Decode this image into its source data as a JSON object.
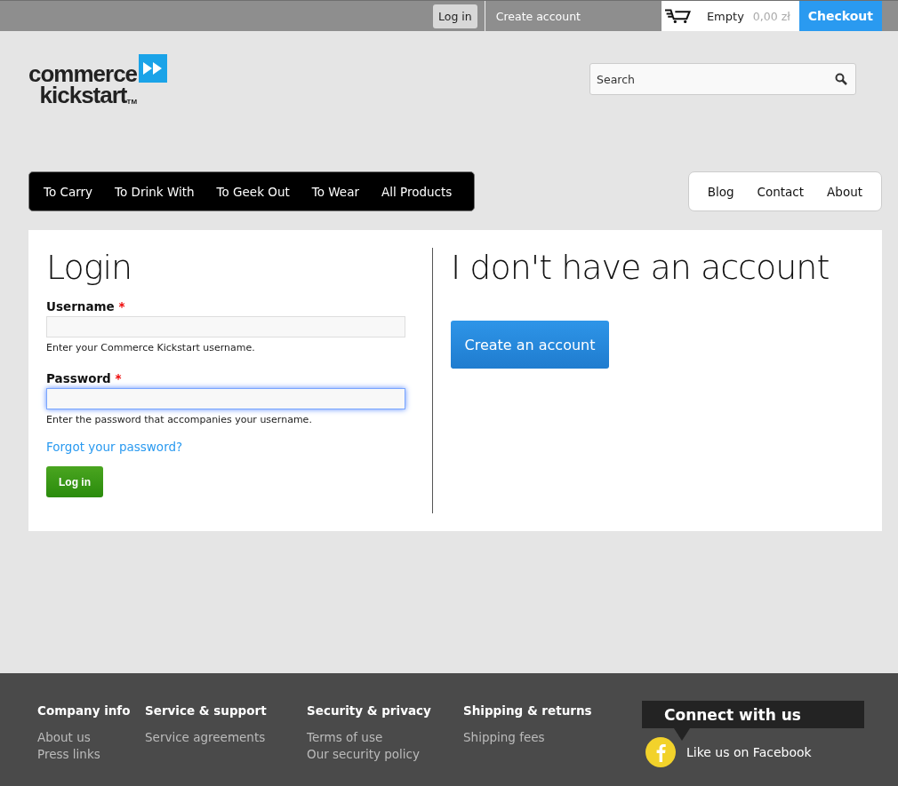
{
  "top_bar": {
    "links": [
      {
        "label": "Log in",
        "selected": true
      },
      {
        "label": "Create account",
        "selected": false
      }
    ],
    "cart": {
      "status": "Empty",
      "total": "0,00 zł"
    },
    "checkout": "Checkout"
  },
  "logo": {
    "line1": "commerce",
    "line2": "kickstart",
    "mark": "TM"
  },
  "search": {
    "placeholder": "Search"
  },
  "main_nav": [
    "To Carry",
    "To Drink With",
    "To Geek Out",
    "To Wear",
    "All Products"
  ],
  "secondary_nav": [
    "Blog",
    "Contact",
    "About"
  ],
  "login": {
    "title": "Login",
    "fields": [
      {
        "label": "Username",
        "required": "*",
        "help": "Enter your Commerce Kickstart username.",
        "focused": false
      },
      {
        "label": "Password",
        "required": "*",
        "help": "Enter the password that accompanies your username.",
        "focused": true
      }
    ],
    "forgot_link": "Forgot your password?",
    "submit": "Log in"
  },
  "register": {
    "title": "I don't have an account",
    "button": "Create an account"
  },
  "footer": {
    "columns": [
      {
        "title": "Company info",
        "links": [
          "About us",
          "Press links"
        ]
      },
      {
        "title": "Service & support",
        "links": [
          "Service agreements"
        ]
      },
      {
        "title": "Security & privacy",
        "links": [
          "Terms of use",
          "Our security policy"
        ]
      },
      {
        "title": "Shipping & returns",
        "links": [
          "Shipping fees"
        ]
      }
    ],
    "connect": {
      "title": "Connect with us",
      "facebook": "Like us on Facebook"
    }
  }
}
